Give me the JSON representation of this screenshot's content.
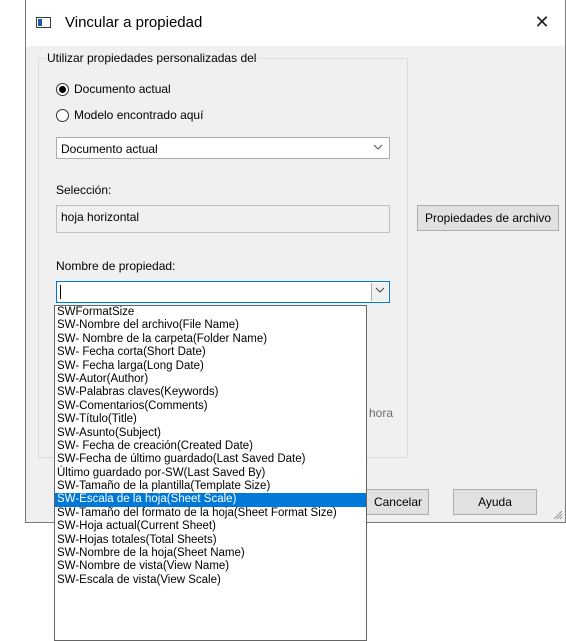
{
  "window": {
    "title": "Vincular a propiedad",
    "close_glyph": "✕"
  },
  "group": {
    "legend": "Utilizar propiedades personalizadas del",
    "radio_current": "Documento actual",
    "radio_model": "Modelo encontrado aquí",
    "source_combo_value": "Documento actual"
  },
  "selection": {
    "label": "Selección:",
    "value": "hoja horizontal"
  },
  "file_properties_button": "Propiedades de archivo",
  "property_name": {
    "label": "Nombre de propiedad:",
    "value": ""
  },
  "partially_hidden": {
    "time_text": "hora",
    "cancel_label": "Cancelar"
  },
  "buttons": {
    "help": "Ayuda"
  },
  "dropdown": {
    "selected_index": 14,
    "items": [
      "SWFormatSize",
      "SW-Nombre del archivo(File Name)",
      "SW- Nombre de la carpeta(Folder Name)",
      "SW- Fecha corta(Short Date)",
      "SW- Fecha larga(Long Date)",
      "SW-Autor(Author)",
      "SW-Palabras claves(Keywords)",
      "SW-Comentarios(Comments)",
      "SW-Título(Title)",
      "SW-Asunto(Subject)",
      "SW- Fecha de creación(Created Date)",
      "SW-Fecha de último guardado(Last Saved Date)",
      "Último guardado por-SW(Last Saved By)",
      "SW-Tamaño de la plantilla(Template Size)",
      "SW-Escala de la hoja(Sheet Scale)",
      "SW-Tamaño del formato de la hoja(Sheet Format Size)",
      "SW-Hoja actual(Current Sheet)",
      "SW-Hojas totales(Total Sheets)",
      "SW-Nombre de la hoja(Sheet Name)",
      "SW-Nombre de vista(View Name)",
      "SW-Escala de vista(View Scale)"
    ]
  },
  "colors": {
    "selection": "#0078d7",
    "dialog_bg": "#f0f0f0"
  }
}
